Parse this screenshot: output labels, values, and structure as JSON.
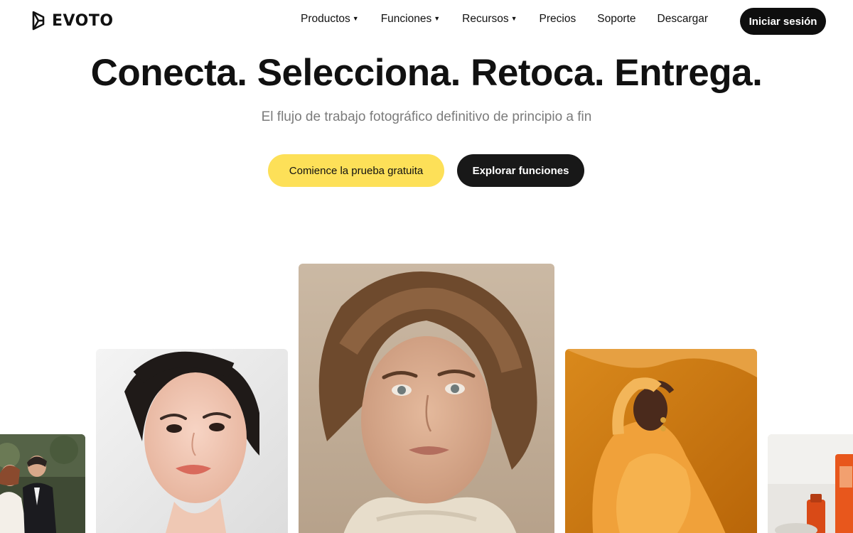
{
  "brand": {
    "name": "EVOTO",
    "logo_icon": "evoto-logo-icon"
  },
  "nav": {
    "items": [
      {
        "label": "Productos",
        "has_dropdown": true
      },
      {
        "label": "Funciones",
        "has_dropdown": true
      },
      {
        "label": "Recursos",
        "has_dropdown": true
      },
      {
        "label": "Precios",
        "has_dropdown": false
      },
      {
        "label": "Soporte",
        "has_dropdown": false
      },
      {
        "label": "Descargar",
        "has_dropdown": false
      }
    ],
    "dropdown_glyph": "▼",
    "login_label": "Iniciar sesión"
  },
  "hero": {
    "title": "Conecta. Selecciona. Retoca. Entrega.",
    "subtitle": "El flujo de trabajo fotográfico definitivo de principio a fin",
    "cta_primary": "Comience la prueba gratuita",
    "cta_secondary": "Explorar funciones"
  },
  "colors": {
    "cta_primary_bg": "#fde058",
    "dark_button_bg": "#0e0e0e",
    "subtitle_text": "#7b7b7b"
  }
}
